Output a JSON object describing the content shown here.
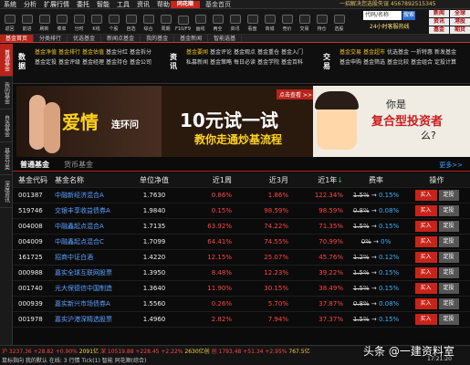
{
  "menu": {
    "items": [
      "系统",
      "分析",
      "扩展行情",
      "委托",
      "智能",
      "工具",
      "资讯",
      "帮助"
    ],
    "logo": "同花顺",
    "window_title": "基金首页"
  },
  "ticker": "一招解决您选股失误     4567892515345",
  "toolbar": {
    "buttons": [
      "返回",
      "前进",
      "刷新",
      "菜单",
      "分时",
      "K线",
      "个股",
      "自选",
      "综合",
      "周期",
      "F10/F9",
      "画线",
      "两全",
      "资讯",
      "看盘",
      "商城",
      "竞价",
      "交易",
      "持仓",
      "选股"
    ],
    "search_placeholder": "代码/名称",
    "search_button": "搜索",
    "phone": "24小时客服热线",
    "right_buttons": [
      "新闻",
      "全球",
      "资讯",
      "港股",
      "基金",
      "期货"
    ]
  },
  "tabs": {
    "items": [
      "基金首页",
      "分类排行",
      "优选基金",
      "新闻点基金",
      "我的基金",
      "基金新闻",
      "智能选基"
    ],
    "active": 0
  },
  "sidebar": {
    "items": [
      "普通基金",
      "我的基金",
      "自选基金",
      "基金分类",
      "深度资讯"
    ],
    "active": 0
  },
  "categories": [
    {
      "head": "数据",
      "links": [
        "基金净值",
        "基金排行",
        "基金估值",
        "基金分红",
        "基金拆分",
        "基金定投",
        "基金评级",
        "基金经理",
        "基金持仓",
        "基金公司"
      ],
      "highlight": [
        0,
        1,
        2
      ]
    },
    {
      "head": "资讯",
      "links": [
        "基金要闻",
        "基金评论",
        "基金观点",
        "基金重仓",
        "基金入门",
        "私募新闻",
        "基金策略",
        "每日必读",
        "基金学院",
        "基金百科"
      ],
      "highlight": [
        0
      ]
    },
    {
      "head": "交易",
      "links": [
        "基金交易",
        "基金超市",
        "优选基金",
        "一折特惠",
        "新发基金",
        "基金申购",
        "基金筛选",
        "基金比较",
        "基金组合",
        "定投计算"
      ],
      "highlight": [
        0,
        1
      ]
    }
  ],
  "banners": {
    "b1_title": "爱情",
    "b1_sub": "连环问",
    "b2_main": "10元试一试",
    "b2_sub": "教你走通炒基流程",
    "b2_button": "点击查看 >>",
    "b3_line1": "你是",
    "b3_line2": "复合型投资者",
    "b3_line3": "么?"
  },
  "subtabs": {
    "items": [
      "普通基金",
      "货币基金"
    ],
    "active": 0,
    "more": "更多>>"
  },
  "table": {
    "headers": [
      "基金代码",
      "基金名称",
      "单位净值",
      "近1周",
      "近3月",
      "近1年",
      "费率",
      "操作"
    ],
    "buy_label": "买入",
    "dca_label": "定投",
    "rows": [
      {
        "code": "001387",
        "name": "中融新经济混合A",
        "nav": "1.7630",
        "w1": "0.86%",
        "m3": "1.86%",
        "y1": "122.34%",
        "fee_old": "1.5%",
        "fee": "0.15%"
      },
      {
        "code": "519746",
        "name": "交银丰享收益债券A",
        "nav": "1.9840",
        "w1": "0.15%",
        "m3": "98.59%",
        "y1": "98.59%",
        "fee_old": "0.8%",
        "fee": "0.08%"
      },
      {
        "code": "004008",
        "name": "中融鑫起点混合A",
        "nav": "1.7135",
        "w1": "63.92%",
        "m3": "74.22%",
        "y1": "71.35%",
        "fee_old": "1.5%",
        "fee": "0.15%"
      },
      {
        "code": "004009",
        "name": "中融鑫起点混合C",
        "nav": "1.7099",
        "w1": "64.41%",
        "m3": "74.55%",
        "y1": "70.99%",
        "fee_old": "0%",
        "fee": "0%"
      },
      {
        "code": "161725",
        "name": "招商中证白酒",
        "nav": "1.4220",
        "w1": "12.15%",
        "m3": "25.07%",
        "y1": "45.76%",
        "fee_old": "1.2%",
        "fee": "0.12%"
      },
      {
        "code": "000988",
        "name": "嘉实全球互联网股票",
        "nav": "1.3950",
        "w1": "8.48%",
        "m3": "12.23%",
        "y1": "39.22%",
        "fee_old": "1.5%",
        "fee": "0.15%"
      },
      {
        "code": "001740",
        "name": "光大保德信中国制造",
        "nav": "1.3640",
        "w1": "11.90%",
        "m3": "30.15%",
        "y1": "38.49%",
        "fee_old": "1.5%",
        "fee": "0.15%"
      },
      {
        "code": "000939",
        "name": "嘉实新兴市场债券A",
        "nav": "1.5560",
        "w1": "0.26%",
        "m3": "5.70%",
        "y1": "37.87%",
        "fee_old": "0.8%",
        "fee": "0.08%"
      },
      {
        "code": "001978",
        "name": "嘉实沪港深精选股票",
        "nav": "1.4960",
        "w1": "2.82%",
        "m3": "7.94%",
        "y1": "37.37%",
        "fee_old": "1.5%",
        "fee": "0.15%"
      }
    ]
  },
  "status": {
    "line1_a": "沪 3237.36",
    "line1_b": "+28.82 +0.90%",
    "line1_c": "2091亿",
    "line1_d": "深 10519.88",
    "line1_e": "+228.45 +2.22%",
    "line1_f": "2630亿创",
    "line1_g": "创 1793.48",
    "line1_h": "+51.34 +2.95%",
    "line1_i": "767.5亿",
    "line2": "鼠标指向 我的默认   在线: 3  行情 Tick(1)  智能 同花顺(综合)",
    "clock": "17:21:20",
    "time2": "17:18 东方财富"
  },
  "watermark": "头条 @一建资料室",
  "colors": {
    "accent": "#b8231a",
    "up": "#ff4545",
    "link": "#3aa0ff"
  }
}
